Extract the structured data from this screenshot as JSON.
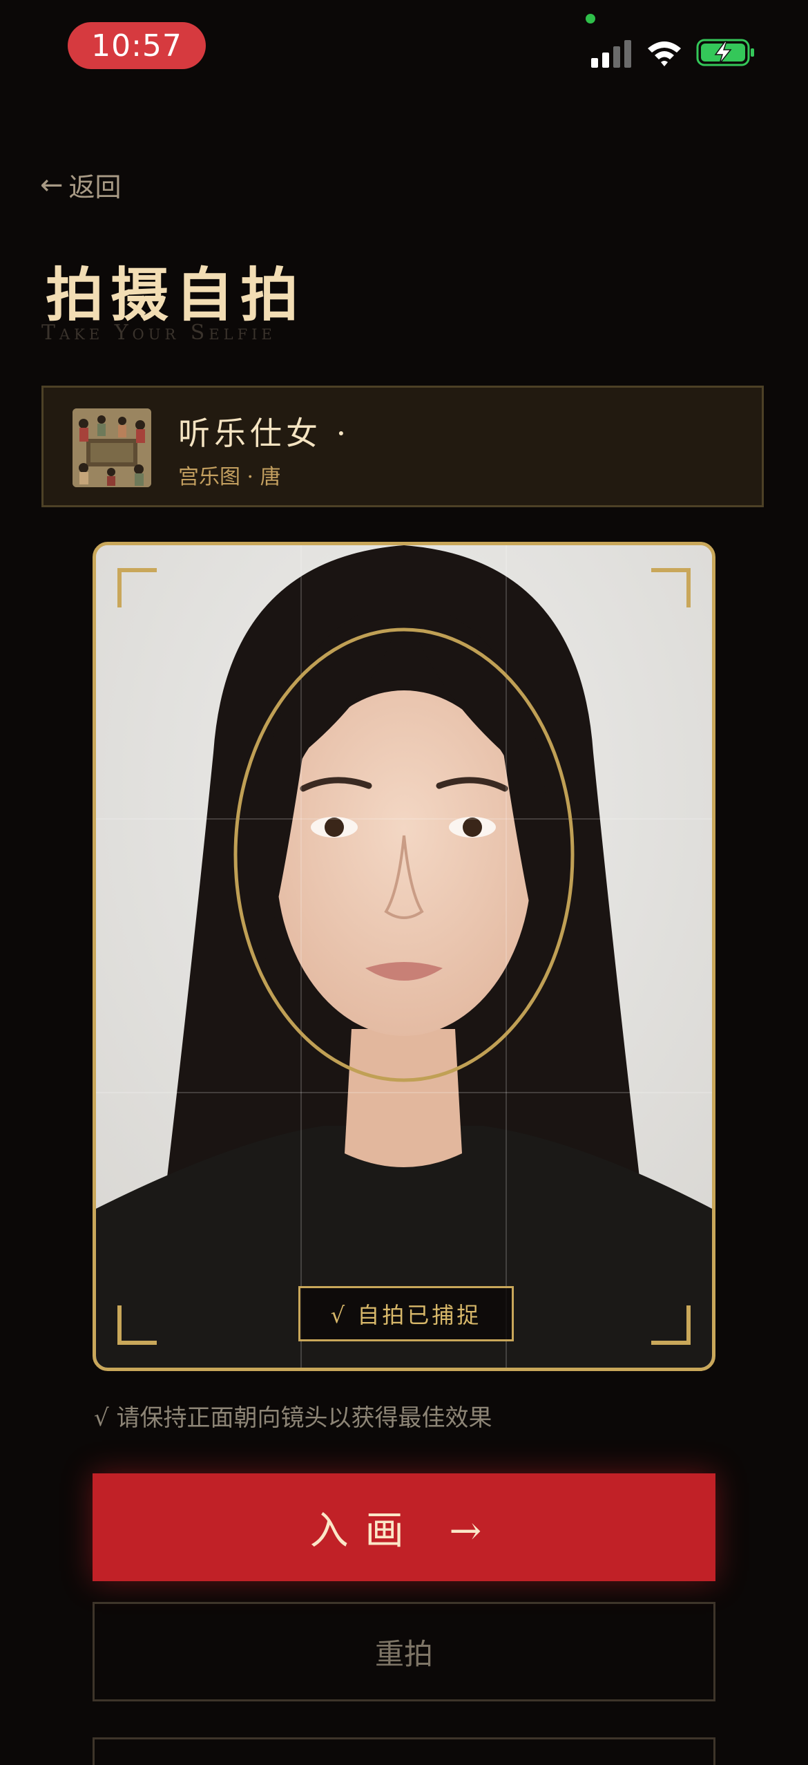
{
  "status_bar": {
    "time": "10:57",
    "icons": [
      "signal-icon",
      "wifi-icon",
      "battery-charging-icon"
    ],
    "colors": {
      "time_pill": "#d63a3f",
      "battery": "#34c759"
    }
  },
  "nav": {
    "back_arrow": "←",
    "back_label": "返回"
  },
  "header": {
    "title": "拍摄自拍",
    "subtitle": "Take Your Selfie"
  },
  "painting": {
    "name": "听乐仕女 ·",
    "meta": "宫乐图 · 唐"
  },
  "camera": {
    "captured_badge": "√ 自拍已捕捉",
    "frame_color": "#c9a75a"
  },
  "hint": "√ 请保持正面朝向镜头以获得最佳效果",
  "buttons": {
    "enter": "入画 →",
    "retake": "重拍"
  },
  "colors": {
    "background": "#0b0807",
    "accent_red": "#c12127",
    "gold": "#c9a75a"
  }
}
